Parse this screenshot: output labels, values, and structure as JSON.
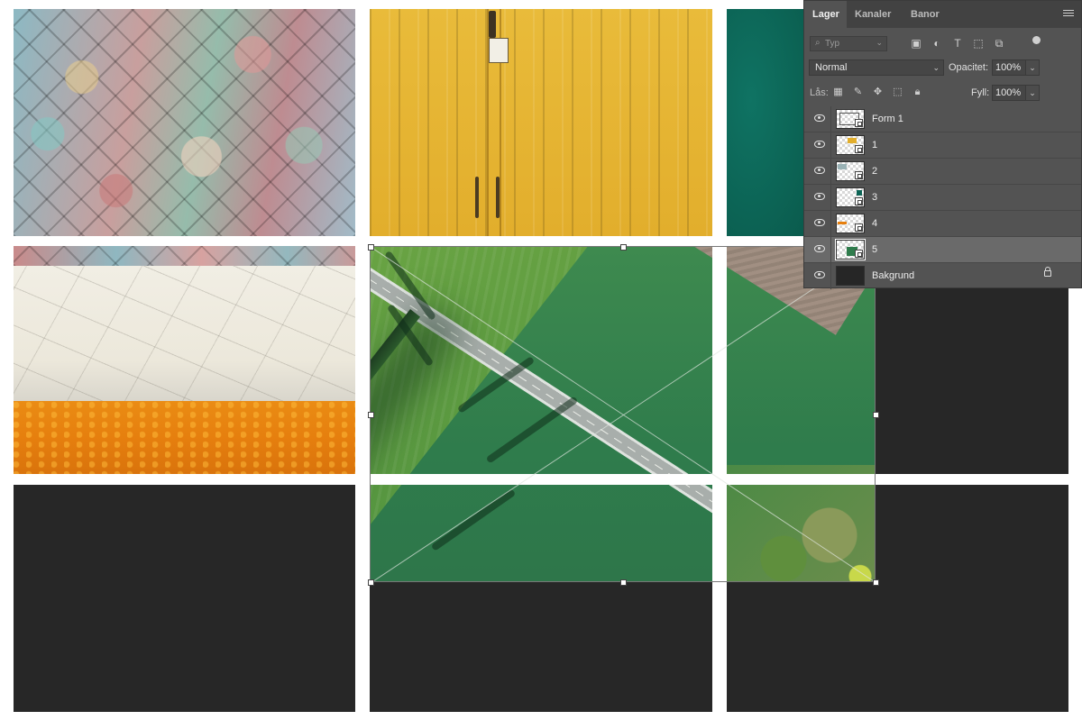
{
  "panel": {
    "tabs": [
      {
        "label": "Lager",
        "active": true
      },
      {
        "label": "Kanaler",
        "active": false
      },
      {
        "label": "Banor",
        "active": false
      }
    ],
    "filter": {
      "kind_placeholder": "Typ",
      "icons": [
        "image-filter-icon",
        "adjustment-filter-icon",
        "type-filter-icon",
        "shape-filter-icon",
        "smart-object-filter-icon"
      ]
    },
    "blend_mode": "Normal",
    "opacity_label": "Opacitet:",
    "opacity_value": "100%",
    "lock_label": "Lås:",
    "fill_label": "Fyll:",
    "fill_value": "100%",
    "layers": [
      {
        "name": "Form 1",
        "type": "shape",
        "visible": true,
        "selected": false
      },
      {
        "name": "1",
        "type": "smart-object",
        "visible": true,
        "selected": false
      },
      {
        "name": "2",
        "type": "smart-object",
        "visible": true,
        "selected": false
      },
      {
        "name": "3",
        "type": "smart-object",
        "visible": true,
        "selected": false
      },
      {
        "name": "4",
        "type": "smart-object",
        "visible": true,
        "selected": false
      },
      {
        "name": "5",
        "type": "smart-object",
        "visible": true,
        "selected": true
      },
      {
        "name": "Bakgrund",
        "type": "background",
        "visible": true,
        "selected": false,
        "locked": true
      }
    ]
  },
  "colors": {
    "canvas_gap": "#ffffff",
    "placeholder": "#272727",
    "panel_bg": "#535353",
    "selected_row": "#6a6a6a"
  }
}
